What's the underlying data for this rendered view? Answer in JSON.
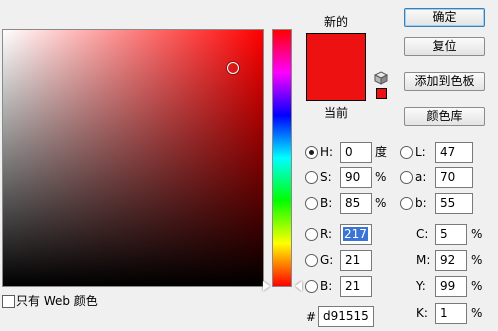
{
  "swatches": {
    "new_label": "新的",
    "current_label": "当前",
    "new_color": "#ee1111",
    "current_color": "#ee1111",
    "web_warning_color": "#ee1111"
  },
  "buttons": {
    "ok": "确定",
    "reset": "复位",
    "add_to_swatches": "添加到色板",
    "color_libraries": "颜色库"
  },
  "hsb": {
    "h": {
      "label": "H:",
      "value": "0",
      "unit": "度",
      "checked": true
    },
    "s": {
      "label": "S:",
      "value": "90",
      "unit": "%"
    },
    "b": {
      "label": "B:",
      "value": "85",
      "unit": "%"
    }
  },
  "lab": {
    "l": {
      "label": "L:",
      "value": "47"
    },
    "a": {
      "label": "a:",
      "value": "70"
    },
    "b": {
      "label": "b:",
      "value": "55"
    }
  },
  "rgb": {
    "r": {
      "label": "R:",
      "value": "217"
    },
    "g": {
      "label": "G:",
      "value": "21"
    },
    "b": {
      "label": "B:",
      "value": "21"
    }
  },
  "cmyk": {
    "c": {
      "label": "C:",
      "value": "5",
      "unit": "%"
    },
    "m": {
      "label": "M:",
      "value": "92",
      "unit": "%"
    },
    "y": {
      "label": "Y:",
      "value": "99",
      "unit": "%"
    },
    "k": {
      "label": "K:",
      "value": "1",
      "unit": "%"
    }
  },
  "hex": {
    "label": "#",
    "value": "d91515"
  },
  "only_web_colors": {
    "label": "只有 Web 颜色",
    "checked": false
  },
  "colors": {
    "accent_selection": "#3a74d6",
    "hue_selected": "#ff0000"
  }
}
